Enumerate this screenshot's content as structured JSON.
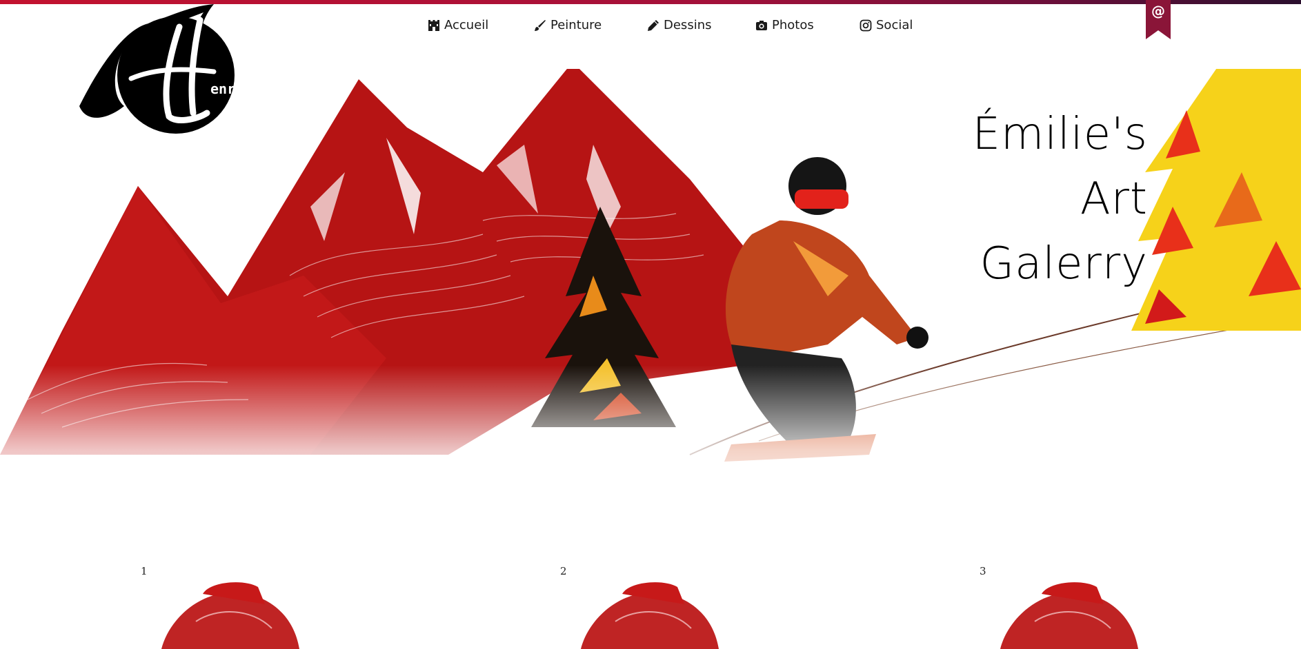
{
  "nav": {
    "items": [
      {
        "label": "Accueil",
        "icon": "castle-icon"
      },
      {
        "label": "Peinture",
        "icon": "brush-icon"
      },
      {
        "label": "Dessins",
        "icon": "pencil-icon"
      },
      {
        "label": "Photos",
        "icon": "camera-icon"
      },
      {
        "label": "Social",
        "icon": "instagram-icon"
      }
    ],
    "contact_symbol": "@"
  },
  "logo": {
    "letter": "H",
    "text": "enry"
  },
  "hero": {
    "title_lines": [
      "Émilie's",
      "Art",
      "Galerry"
    ]
  },
  "gallery": {
    "items": [
      {
        "number": "1"
      },
      {
        "number": "2"
      },
      {
        "number": "3"
      }
    ]
  },
  "colors": {
    "accent": "#c3122f",
    "ribbon": "#8a1538",
    "mountain": "#b00000"
  }
}
